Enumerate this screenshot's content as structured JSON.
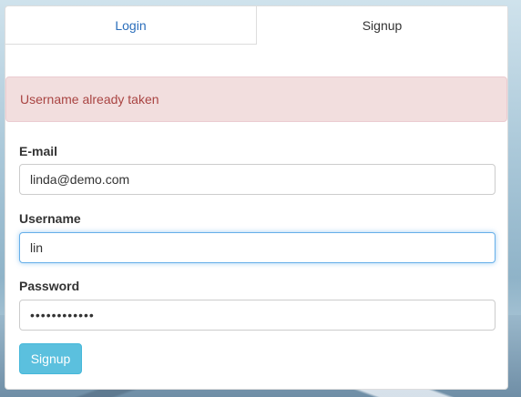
{
  "tabs": {
    "login_label": "Login",
    "signup_label": "Signup"
  },
  "alert": {
    "message": "Username already taken"
  },
  "form": {
    "email_label": "E-mail",
    "email_value": "linda@demo.com",
    "username_label": "Username",
    "username_value": "lin",
    "password_label": "Password",
    "password_value": "••••••••••••",
    "submit_label": "Signup"
  },
  "colors": {
    "alert_bg": "#f2dede",
    "alert_text": "#a94442",
    "button_bg": "#5bc0de",
    "link_blue": "#2a6ebb"
  }
}
